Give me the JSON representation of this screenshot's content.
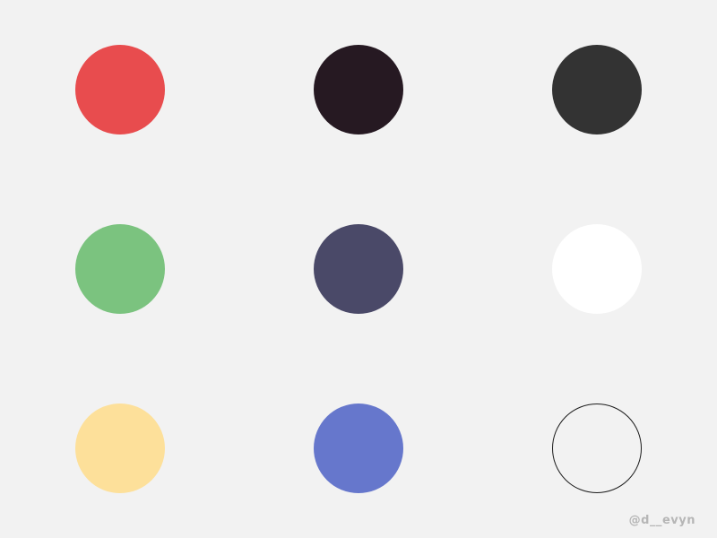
{
  "palette": {
    "background": "#f2f2f2",
    "swatches": [
      {
        "name": "red",
        "color": "#e84c4e",
        "style": "filled"
      },
      {
        "name": "dark-plum",
        "color": "#261922",
        "style": "filled"
      },
      {
        "name": "charcoal",
        "color": "#333333",
        "style": "filled"
      },
      {
        "name": "green",
        "color": "#7bc37f",
        "style": "filled"
      },
      {
        "name": "slate-indigo",
        "color": "#4a4968",
        "style": "filled"
      },
      {
        "name": "white",
        "color": "#ffffff",
        "style": "filled"
      },
      {
        "name": "pale-yellow",
        "color": "#fde09a",
        "style": "filled"
      },
      {
        "name": "periwinkle",
        "color": "#6677cc",
        "style": "filled"
      },
      {
        "name": "outline",
        "color": "#1b1b1b",
        "style": "outline"
      }
    ]
  },
  "credit": {
    "handle": "@d__evyn"
  }
}
